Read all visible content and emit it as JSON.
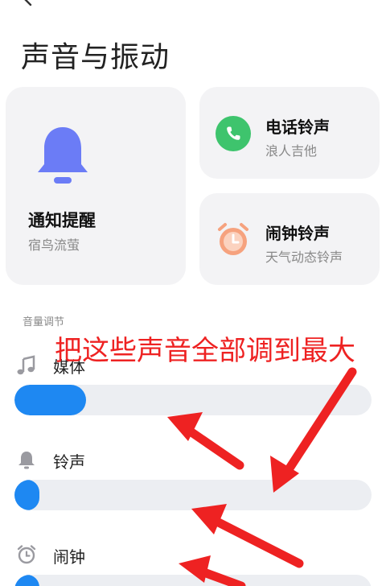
{
  "page": {
    "title": "声音与振动"
  },
  "cards": {
    "notify": {
      "title": "通知提醒",
      "subtitle": "宿鸟流萤",
      "icon": "bell-icon"
    },
    "phone": {
      "title": "电话铃声",
      "subtitle": "浪人吉他",
      "icon": "phone-icon"
    },
    "alarm": {
      "title": "闹钟铃声",
      "subtitle": "天气动态铃声",
      "icon": "alarm-clock-icon"
    }
  },
  "volume": {
    "section_label": "音量调节",
    "rows": [
      {
        "label": "媒体",
        "icon": "music-note-icon",
        "level": 0.2
      },
      {
        "label": "铃声",
        "icon": "bell-icon",
        "level": 0.07
      },
      {
        "label": "闹钟",
        "icon": "alarm-clock-icon",
        "level": 0.07
      }
    ]
  },
  "annotation": {
    "text": "把这些声音全部调到最大"
  },
  "colors": {
    "accent": "#1e88f2",
    "annotation": "#ee2222",
    "bell": "#6b7cf6",
    "phone_green": "#3ec46d",
    "alarm_orange": "#f6a27e",
    "card_bg": "#f3f3f5",
    "track_bg": "#eceef2"
  }
}
